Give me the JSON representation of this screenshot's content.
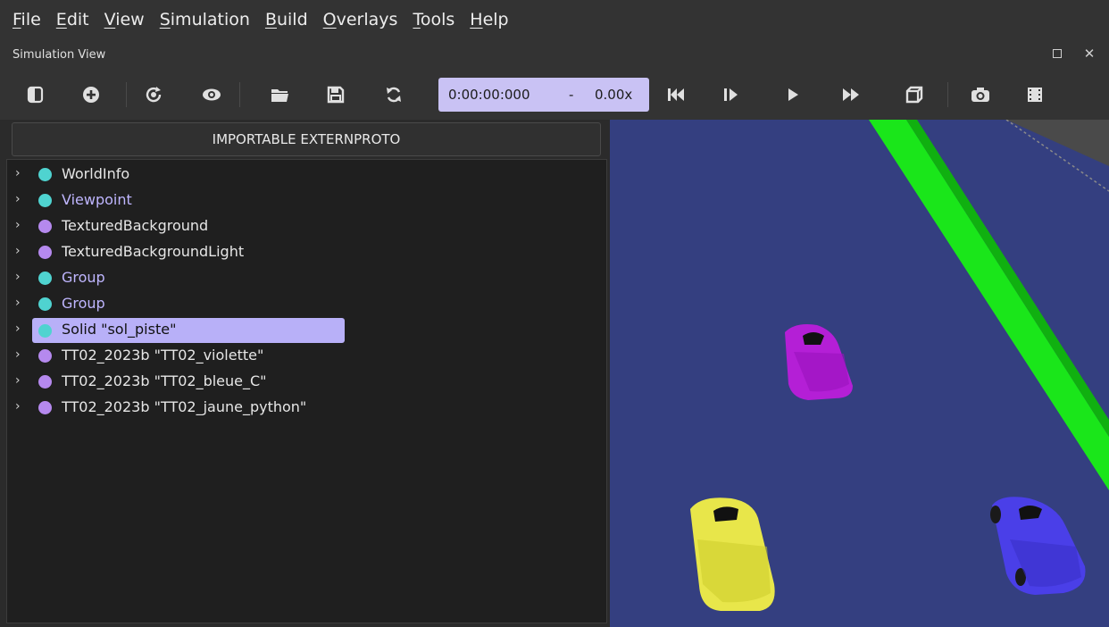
{
  "menubar": {
    "items": [
      {
        "first": "F",
        "rest": "ile"
      },
      {
        "first": "E",
        "rest": "dit"
      },
      {
        "first": "V",
        "rest": "iew"
      },
      {
        "first": "S",
        "rest": "imulation"
      },
      {
        "first": "B",
        "rest": "uild"
      },
      {
        "first": "O",
        "rest": "verlays"
      },
      {
        "first": "T",
        "rest": "ools"
      },
      {
        "first": "H",
        "rest": "elp"
      }
    ]
  },
  "dock": {
    "title": "Simulation View",
    "close_glyph": "✕"
  },
  "toolbar": {
    "time": "0:00:00:000",
    "speed_separator": "-",
    "speed": "0.00x",
    "icons": [
      "hide-scene-tree-icon",
      "add-node-icon",
      "reset-view-icon",
      "visibility-icon",
      "open-world-icon",
      "save-world-icon",
      "reload-world-icon",
      "step-back-icon",
      "step-icon",
      "play-icon",
      "fast-forward-icon",
      "render-3d-icon",
      "screenshot-icon",
      "record-movie-icon"
    ]
  },
  "importable_button": "IMPORTABLE EXTERNPROTO",
  "tree": {
    "rows": [
      {
        "label": "WorldInfo",
        "dot_color": "#4fd3d0",
        "text_color": "#e6e6e6"
      },
      {
        "label": "Viewpoint",
        "dot_color": "#4fd3d0",
        "text_color": "#bfb6ff"
      },
      {
        "label": "TexturedBackground",
        "dot_color": "#b589ee",
        "text_color": "#e6e6e6"
      },
      {
        "label": "TexturedBackgroundLight",
        "dot_color": "#b589ee",
        "text_color": "#e6e6e6"
      },
      {
        "label": "Group",
        "dot_color": "#4fd3d0",
        "text_color": "#bfb6ff"
      },
      {
        "label": "Group",
        "dot_color": "#4fd3d0",
        "text_color": "#bfb6ff"
      },
      {
        "label": "Solid \"sol_piste\"",
        "dot_color": "#4fd3d0",
        "text_color": "#111111",
        "selected": true
      },
      {
        "label": "TT02_2023b \"TT02_violette\"",
        "dot_color": "#b589ee",
        "text_color": "#e6e6e6"
      },
      {
        "label": "TT02_2023b \"TT02_bleue_C\"",
        "dot_color": "#b589ee",
        "text_color": "#e6e6e6"
      },
      {
        "label": "TT02_2023b \"TT02_jaune_python\"",
        "dot_color": "#b589ee",
        "text_color": "#e6e6e6"
      }
    ]
  },
  "scene": {
    "colors": {
      "floor": "#343f80",
      "wall": "#1ae61a",
      "car_violet": "#b41fd6",
      "car_yellow": "#e8e64a",
      "car_blue": "#4a3fe8"
    }
  }
}
